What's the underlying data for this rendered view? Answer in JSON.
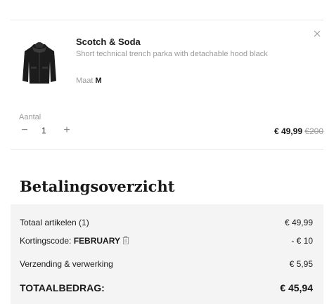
{
  "product": {
    "brand": "Scotch & Soda",
    "description": "Short technical trench parka with detachable hood black",
    "size_label": "Maat",
    "size_value": "M",
    "image_icon": "black-parka-jacket"
  },
  "quantity": {
    "label": "Aantal",
    "value": "1",
    "minus": "−",
    "plus": "+"
  },
  "price": {
    "current": "€ 49,99",
    "original": "€200"
  },
  "summary": {
    "title": "Betalingsoverzicht",
    "articles_label": "Totaal artikelen (1)",
    "articles_amount": "€ 49,99",
    "coupon_label": "Kortingscode: ",
    "coupon_code": "FEBRUARY",
    "coupon_amount": "- € 10",
    "shipping_label": "Verzending & verwerking",
    "shipping_amount": "€ 5,95",
    "total_label": "TOTAALBEDRAG:",
    "total_amount": "€ 45,94"
  },
  "colors": {
    "text": "#1a1a1a",
    "muted": "#9a9a9a",
    "summary_bg": "#f4f4f4",
    "divider": "#e8e8e8"
  }
}
